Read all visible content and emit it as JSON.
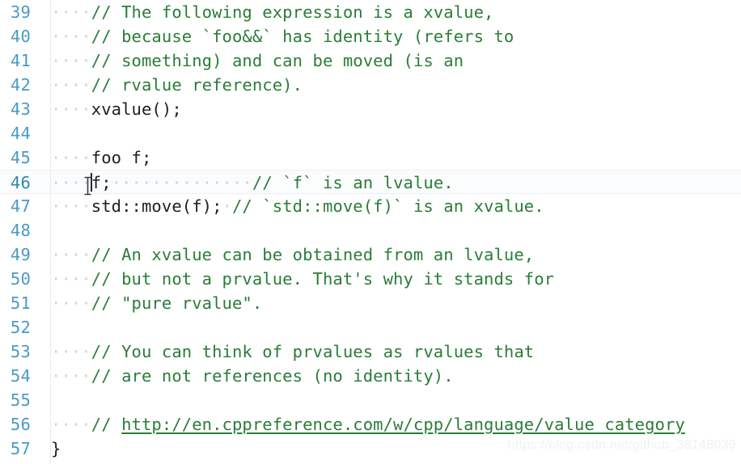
{
  "editor": {
    "language": "cpp",
    "colors": {
      "background": "#ffffff",
      "line_number": "#4a9ac4",
      "current_line_number": "#2e8aa8",
      "comment": "#2a7d37",
      "code": "#1b1f23",
      "whitespace_dot": "#d3d3d3",
      "current_line_bg": "#fbfcfd",
      "gutter_rule": "#ececec",
      "watermark": "#f0f1f2"
    },
    "current_line": 46,
    "caret": {
      "line": 46,
      "column": 5
    },
    "mouse_cursor": "text-ibeam-cursor",
    "lines": [
      {
        "number": "39",
        "indent": 4,
        "segments": [
          {
            "kind": "comment",
            "text": "// The following expression is a xvalue,"
          }
        ]
      },
      {
        "number": "40",
        "indent": 4,
        "segments": [
          {
            "kind": "comment",
            "text": "// because `foo&&` has identity (refers to"
          }
        ]
      },
      {
        "number": "41",
        "indent": 4,
        "segments": [
          {
            "kind": "comment",
            "text": "// something) and can be moved (is an"
          }
        ]
      },
      {
        "number": "42",
        "indent": 4,
        "segments": [
          {
            "kind": "comment",
            "text": "// rvalue reference)."
          }
        ]
      },
      {
        "number": "43",
        "indent": 4,
        "segments": [
          {
            "kind": "code",
            "text": "xvalue();"
          }
        ]
      },
      {
        "number": "44",
        "indent": 0,
        "segments": []
      },
      {
        "number": "45",
        "indent": 4,
        "segments": [
          {
            "kind": "code",
            "text": "foo f;"
          }
        ]
      },
      {
        "number": "46",
        "indent": 4,
        "current": true,
        "caret_after_indent": true,
        "segments": [
          {
            "kind": "code",
            "text": "f;"
          },
          {
            "kind": "whitespace",
            "count": 14
          },
          {
            "kind": "comment",
            "text": "// `f` is an lvalue."
          }
        ]
      },
      {
        "number": "47",
        "indent": 4,
        "segments": [
          {
            "kind": "code",
            "text": "std::move(f);"
          },
          {
            "kind": "whitespace",
            "count": 1
          },
          {
            "kind": "comment",
            "text": "// `std::move(f)` is an xvalue."
          }
        ]
      },
      {
        "number": "48",
        "indent": 0,
        "segments": []
      },
      {
        "number": "49",
        "indent": 4,
        "segments": [
          {
            "kind": "comment",
            "text": "// An xvalue can be obtained from an lvalue,"
          }
        ]
      },
      {
        "number": "50",
        "indent": 4,
        "segments": [
          {
            "kind": "comment",
            "text": "// but not a prvalue. That's why it stands for"
          }
        ]
      },
      {
        "number": "51",
        "indent": 4,
        "segments": [
          {
            "kind": "comment",
            "text": "// \"pure rvalue\"."
          }
        ]
      },
      {
        "number": "52",
        "indent": 0,
        "segments": []
      },
      {
        "number": "53",
        "indent": 4,
        "segments": [
          {
            "kind": "comment",
            "text": "// You can think of prvalues as rvalues that"
          }
        ]
      },
      {
        "number": "54",
        "indent": 4,
        "segments": [
          {
            "kind": "comment",
            "text": "// are not references (no identity)."
          }
        ]
      },
      {
        "number": "55",
        "indent": 0,
        "segments": []
      },
      {
        "number": "56",
        "indent": 4,
        "segments": [
          {
            "kind": "comment",
            "text": "// "
          },
          {
            "kind": "link",
            "text": "http://en.cppreference.com/w/cpp/language/value_category"
          }
        ]
      },
      {
        "number": "57",
        "indent": 0,
        "segments": [
          {
            "kind": "code",
            "text": "}"
          }
        ]
      }
    ]
  },
  "watermark": {
    "text": "https://blog.csdn.net/github_38148039"
  }
}
